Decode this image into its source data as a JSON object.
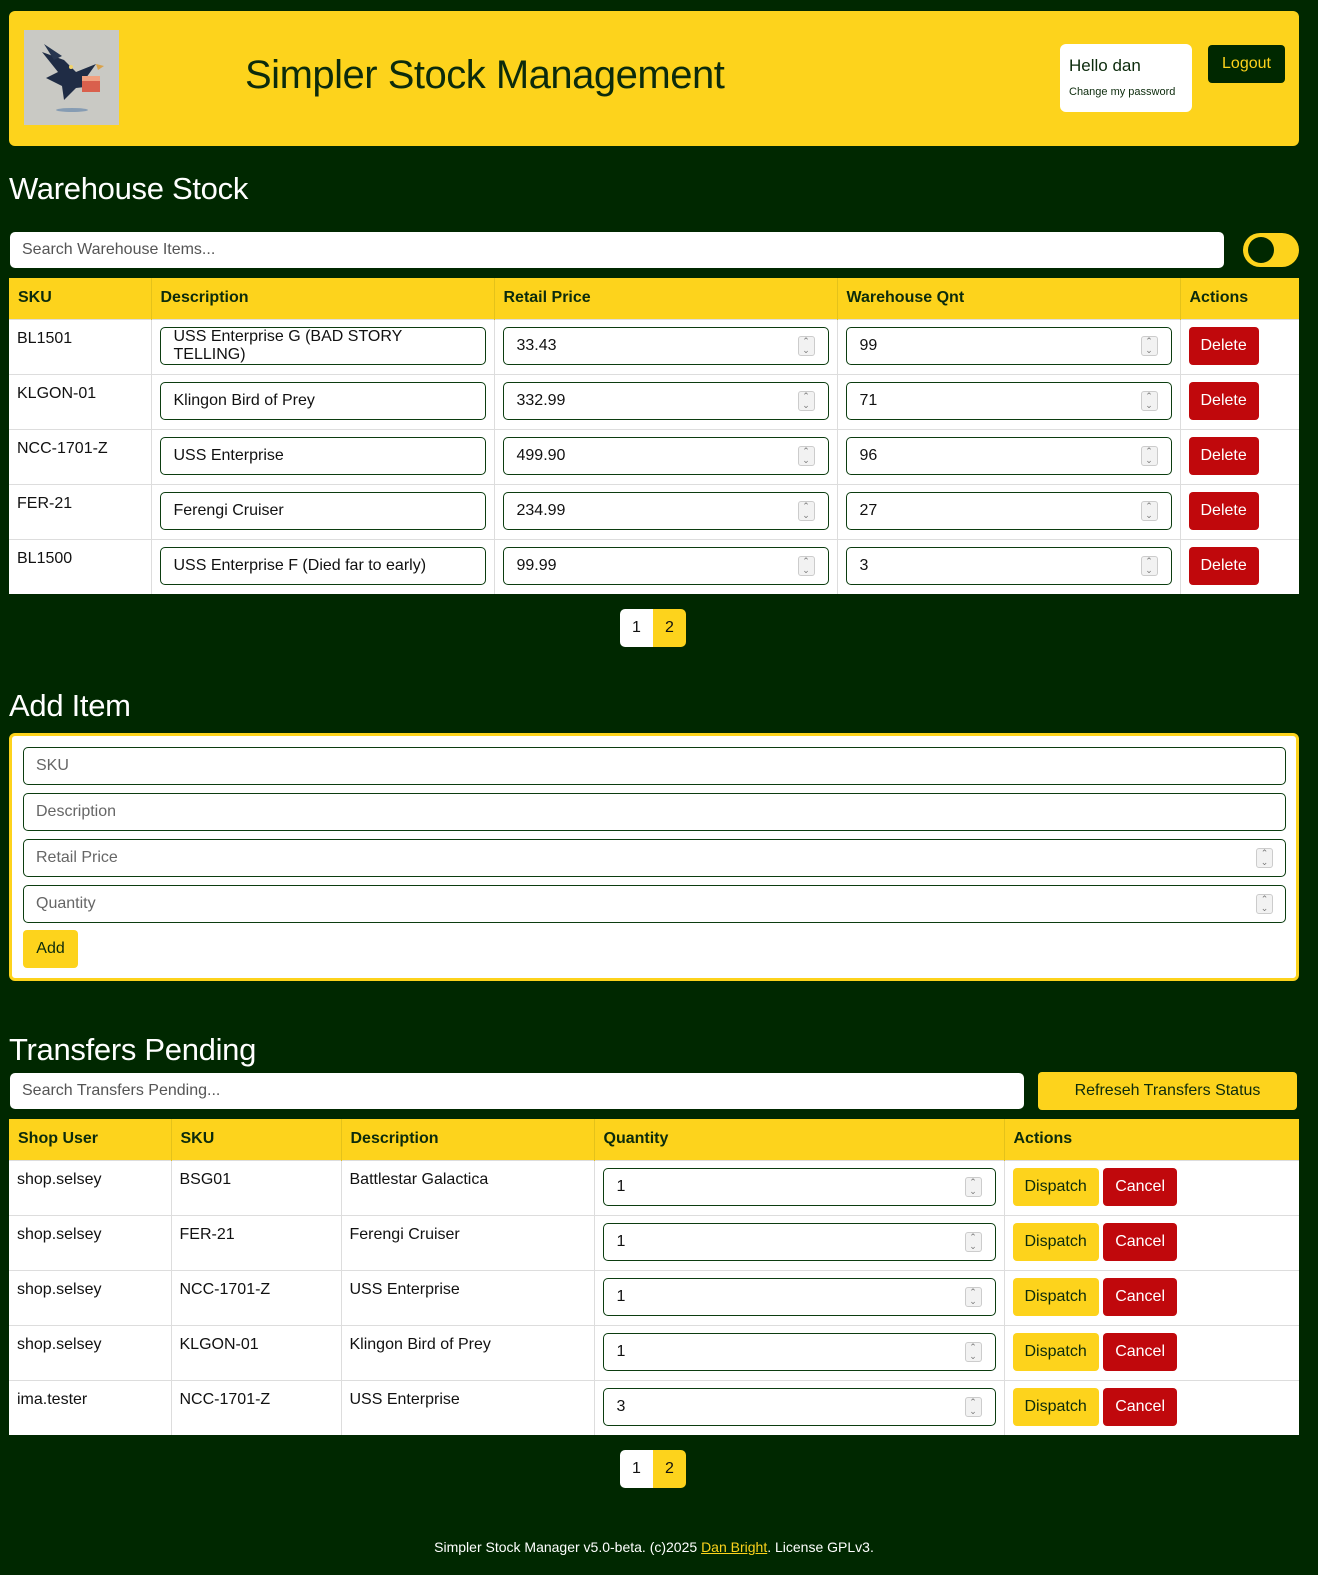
{
  "header": {
    "title": "Simpler Stock Management",
    "hello": "Hello dan",
    "change_password": "Change my password",
    "logout": "Logout"
  },
  "warehouse": {
    "heading": "Warehouse Stock",
    "search_placeholder": "Search Warehouse Items...",
    "columns": [
      "SKU",
      "Description",
      "Retail Price",
      "Warehouse Qnt",
      "Actions"
    ],
    "rows": [
      {
        "sku": "BL1501",
        "description": "USS Enterprise G (BAD STORY TELLING)",
        "price": "33.43",
        "qty": "99",
        "action": "Delete"
      },
      {
        "sku": "KLGON-01",
        "description": "Klingon Bird of Prey",
        "price": "332.99",
        "qty": "71",
        "action": "Delete"
      },
      {
        "sku": "NCC-1701-Z",
        "description": "USS Enterprise",
        "price": "499.90",
        "qty": "96",
        "action": "Delete"
      },
      {
        "sku": "FER-21",
        "description": "Ferengi Cruiser",
        "price": "234.99",
        "qty": "27",
        "action": "Delete"
      },
      {
        "sku": "BL1500",
        "description": "USS Enterprise F (Died far to early)",
        "price": "99.99",
        "qty": "3",
        "action": "Delete"
      }
    ],
    "pages": [
      "1",
      "2"
    ]
  },
  "add_item": {
    "heading": "Add Item",
    "sku_placeholder": "SKU",
    "description_placeholder": "Description",
    "price_placeholder": "Retail Price",
    "quantity_placeholder": "Quantity",
    "add_label": "Add"
  },
  "transfers": {
    "heading": "Transfers Pending",
    "search_placeholder": "Search Transfers Pending...",
    "refresh_label": "Refreseh Transfers Status",
    "columns": [
      "Shop User",
      "SKU",
      "Description",
      "Quantity",
      "Actions"
    ],
    "rows": [
      {
        "user": "shop.selsey",
        "sku": "BSG01",
        "description": "Battlestar Galactica",
        "qty": "1",
        "dispatch": "Dispatch",
        "cancel": "Cancel"
      },
      {
        "user": "shop.selsey",
        "sku": "FER-21",
        "description": "Ferengi Cruiser",
        "qty": "1",
        "dispatch": "Dispatch",
        "cancel": "Cancel"
      },
      {
        "user": "shop.selsey",
        "sku": "NCC-1701-Z",
        "description": "USS Enterprise",
        "qty": "1",
        "dispatch": "Dispatch",
        "cancel": "Cancel"
      },
      {
        "user": "shop.selsey",
        "sku": "KLGON-01",
        "description": "Klingon Bird of Prey",
        "qty": "1",
        "dispatch": "Dispatch",
        "cancel": "Cancel"
      },
      {
        "user": "ima.tester",
        "sku": "NCC-1701-Z",
        "description": "USS Enterprise",
        "qty": "3",
        "dispatch": "Dispatch",
        "cancel": "Cancel"
      }
    ],
    "pages": [
      "1",
      "2"
    ]
  },
  "footer": {
    "prefix": "Simpler Stock Manager v5.0-beta. (c)2025 ",
    "author": "Dan Bright",
    "suffix": ". License GPLv3."
  },
  "colors": {
    "background": "#002800",
    "accent": "#fdd31c",
    "danger": "#c0080c"
  },
  "icons": {
    "logo": "raven-carrying-box-logo",
    "spinner": "number-spinner-icon"
  }
}
